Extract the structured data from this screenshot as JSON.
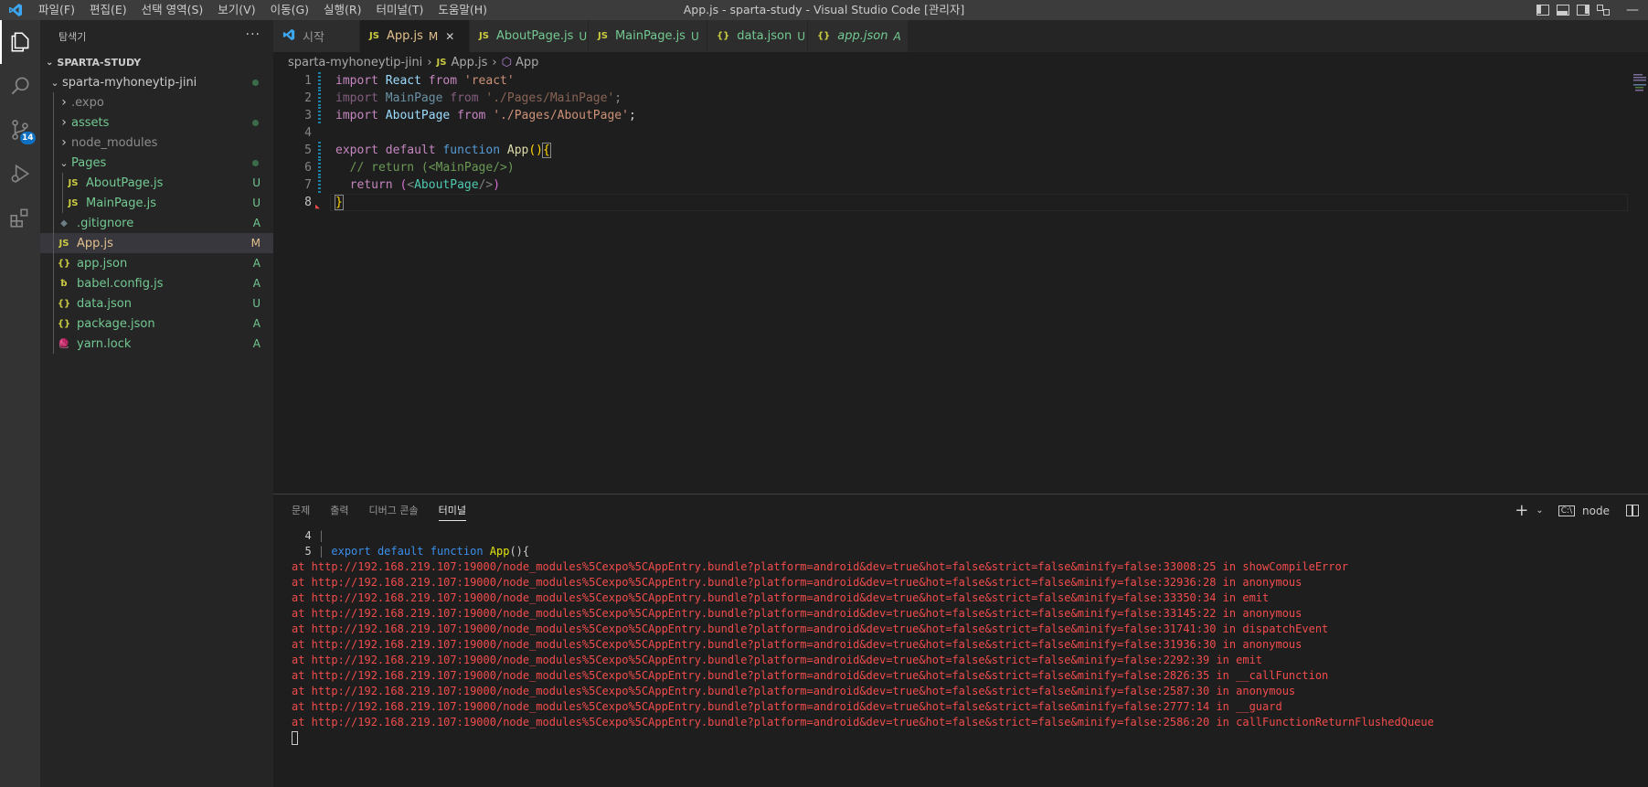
{
  "titlebar": {
    "menu": [
      "파일(F)",
      "편집(E)",
      "선택 영역(S)",
      "보기(V)",
      "이동(G)",
      "실행(R)",
      "터미널(T)",
      "도움말(H)"
    ],
    "title": "App.js - sparta-study - Visual Studio Code [관리자]"
  },
  "activity": {
    "scm_badge": "14"
  },
  "sidebar": {
    "header": "탐색기",
    "more": "···",
    "section": "SPARTA-STUDY",
    "tree": [
      {
        "label": "sparta-myhoneytip-jini",
        "status": "",
        "icon": "",
        "dot": true
      },
      {
        "label": ".expo",
        "status": "",
        "icon": ""
      },
      {
        "label": "assets",
        "status": "",
        "icon": "",
        "dot": true
      },
      {
        "label": "node_modules",
        "status": "",
        "icon": ""
      },
      {
        "label": "Pages",
        "status": "",
        "icon": "",
        "dot": true
      },
      {
        "label": "AboutPage.js",
        "status": "U",
        "icon": "JS"
      },
      {
        "label": "MainPage.js",
        "status": "U",
        "icon": "JS"
      },
      {
        "label": ".gitignore",
        "status": "A",
        "icon": "◆"
      },
      {
        "label": "App.js",
        "status": "M",
        "icon": "JS"
      },
      {
        "label": "app.json",
        "status": "A",
        "icon": "{}"
      },
      {
        "label": "babel.config.js",
        "status": "A",
        "icon": "ƀ"
      },
      {
        "label": "data.json",
        "status": "U",
        "icon": "{}"
      },
      {
        "label": "package.json",
        "status": "A",
        "icon": "{}"
      },
      {
        "label": "yarn.lock",
        "status": "A",
        "icon": "🧶"
      }
    ]
  },
  "tabs": [
    {
      "label": "시작",
      "status": "",
      "icon": "vscode"
    },
    {
      "label": "App.js",
      "status": "M",
      "icon": "JS"
    },
    {
      "label": "AboutPage.js",
      "status": "U",
      "icon": "JS"
    },
    {
      "label": "MainPage.js",
      "status": "U",
      "icon": "JS"
    },
    {
      "label": "data.json",
      "status": "U",
      "icon": "{}"
    },
    {
      "label": "app.json",
      "status": "A",
      "icon": "{}"
    }
  ],
  "breadcrumb": [
    "sparta-myhoneytip-jini",
    "App.js",
    "App"
  ],
  "editor": {
    "line_numbers": [
      "1",
      "2",
      "3",
      "4",
      "5",
      "6",
      "7",
      "8"
    ]
  },
  "panel": {
    "tabs": [
      "문제",
      "출력",
      "디버그 콘솔",
      "터미널"
    ],
    "active_tab": "터미널",
    "shell": "node",
    "terminal_context": [
      {
        "num": "4",
        "text": "|"
      },
      {
        "num": "5",
        "text": "| export default function App(){"
      }
    ],
    "stack_prefix": "at http://192.168.219.107:19000/node_modules%5Cexpo%5CAppEntry.bundle?platform=android&dev=true&hot=false&strict=false&minify=false:",
    "stack": [
      "at http://192.168.219.107:19000/node_modules%5Cexpo%5CAppEntry.bundle?platform=android&dev=true&hot=false&strict=false&minify=false:33008:25 in showCompileError",
      "at http://192.168.219.107:19000/node_modules%5Cexpo%5CAppEntry.bundle?platform=android&dev=true&hot=false&strict=false&minify=false:32936:28 in anonymous",
      "at http://192.168.219.107:19000/node_modules%5Cexpo%5CAppEntry.bundle?platform=android&dev=true&hot=false&strict=false&minify=false:33350:34 in emit",
      "at http://192.168.219.107:19000/node_modules%5Cexpo%5CAppEntry.bundle?platform=android&dev=true&hot=false&strict=false&minify=false:33145:22 in anonymous",
      "at http://192.168.219.107:19000/node_modules%5Cexpo%5CAppEntry.bundle?platform=android&dev=true&hot=false&strict=false&minify=false:31741:30 in dispatchEvent",
      "at http://192.168.219.107:19000/node_modules%5Cexpo%5CAppEntry.bundle?platform=android&dev=true&hot=false&strict=false&minify=false:31936:30 in anonymous",
      "at http://192.168.219.107:19000/node_modules%5Cexpo%5CAppEntry.bundle?platform=android&dev=true&hot=false&strict=false&minify=false:2292:39 in emit",
      "at http://192.168.219.107:19000/node_modules%5Cexpo%5CAppEntry.bundle?platform=android&dev=true&hot=false&strict=false&minify=false:2826:35 in __callFunction",
      "at http://192.168.219.107:19000/node_modules%5Cexpo%5CAppEntry.bundle?platform=android&dev=true&hot=false&strict=false&minify=false:2587:30 in anonymous",
      "at http://192.168.219.107:19000/node_modules%5Cexpo%5CAppEntry.bundle?platform=android&dev=true&hot=false&strict=false&minify=false:2777:14 in __guard",
      "at http://192.168.219.107:19000/node_modules%5Cexpo%5CAppEntry.bundle?platform=android&dev=true&hot=false&strict=false&minify=false:2586:20 in callFunctionReturnFlushedQueue"
    ]
  },
  "colors": {
    "accent": "#0e70c0",
    "error_text": "#f14c4c",
    "untracked": "#73c991",
    "modified": "#e2c08d"
  }
}
